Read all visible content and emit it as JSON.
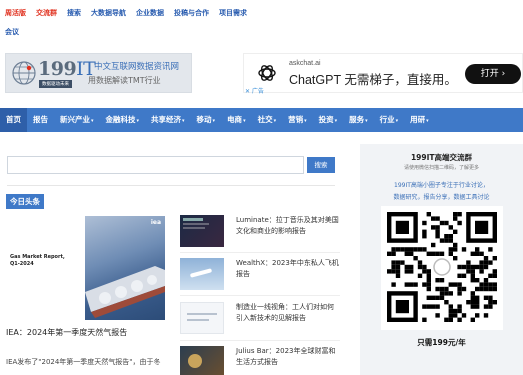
{
  "topbar": {
    "links": [
      {
        "label": "周活版",
        "color": "red"
      },
      {
        "label": "交流群",
        "color": "red"
      },
      {
        "label": "搜索",
        "color": "blue"
      },
      {
        "label": "大数据导航",
        "color": "blue"
      },
      {
        "label": "企业数据",
        "color": "blue"
      },
      {
        "label": "投稿与合作",
        "color": "blue"
      },
      {
        "label": "项目需求",
        "color": "blue"
      }
    ],
    "second_link": "会议"
  },
  "logo": {
    "number": "199",
    "it": "IT",
    "subtitle": "数据驱动未来",
    "tagline1": "中文互联网数据资讯网",
    "tagline2": "用数据解读TMT行业"
  },
  "ad": {
    "domain": "askchat.ai",
    "title": "ChatGPT 无需梯子，直接用。",
    "button": "打开 ›",
    "ad_label": "✕ 广告"
  },
  "nav": {
    "items": [
      {
        "label": "首页",
        "active": true,
        "caret": false
      },
      {
        "label": "报告",
        "active": false,
        "caret": false
      },
      {
        "label": "新兴产业",
        "active": false,
        "caret": true
      },
      {
        "label": "金融科技",
        "active": false,
        "caret": true
      },
      {
        "label": "共享经济",
        "active": false,
        "caret": true
      },
      {
        "label": "移动",
        "active": false,
        "caret": true
      },
      {
        "label": "电商",
        "active": false,
        "caret": true
      },
      {
        "label": "社交",
        "active": false,
        "caret": true
      },
      {
        "label": "营销",
        "active": false,
        "caret": true
      },
      {
        "label": "投资",
        "active": false,
        "caret": true
      },
      {
        "label": "服务",
        "active": false,
        "caret": true
      },
      {
        "label": "行业",
        "active": false,
        "caret": true
      },
      {
        "label": "用研",
        "active": false,
        "caret": true
      }
    ]
  },
  "search": {
    "placeholder": "",
    "button": "搜索"
  },
  "section": {
    "tag": "今日头条"
  },
  "feature": {
    "image_logo": "iea",
    "image_title_line1": "Gas Market Report,",
    "image_title_line2": "Q1-2024",
    "caption": "IEA：2024年第一季度天然气报告",
    "desc": "IEA发布了\"2024年第一季度天然气报告\"，由于冬"
  },
  "news": [
    {
      "text": "Luminate：拉丁音乐及其对美国文化和商业的影响报告",
      "thumb": "dark"
    },
    {
      "text": "WealthX：2023年中东私人飞机报告",
      "thumb": "sky"
    },
    {
      "text": "制造业一线视角：工人们对如何引入新技术的见解报告",
      "thumb": "white"
    },
    {
      "text": "Julius Bar：2023年全球财富和生活方式报告",
      "thumb": "wealth"
    }
  ],
  "sidebar": {
    "title": "199IT高端交流群",
    "subtitle": "请使用微信扫描二维码，了解更多",
    "line1": "199IT高端小圈子专注于行业讨论，",
    "line2": "数据研究，报告分享，数据工具讨论",
    "price": "只需199元/年"
  },
  "colors": {
    "brand_blue": "#3f79c8",
    "nav_active": "#2e5fa9",
    "link_red": "#e0301e",
    "link_blue": "#2a5db0"
  }
}
